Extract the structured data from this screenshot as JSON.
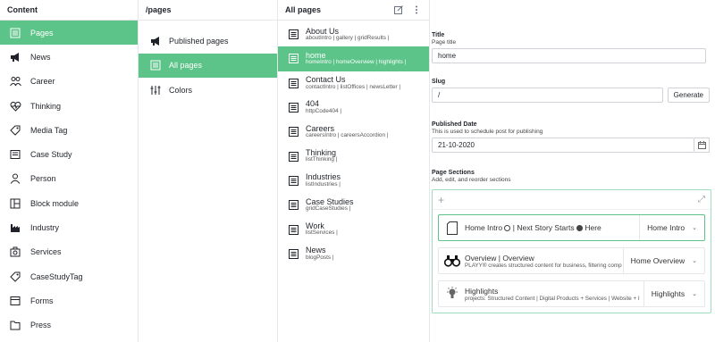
{
  "content_pane": {
    "title": "Content",
    "items": [
      {
        "label": "Pages",
        "icon": "pages-icon",
        "active": true
      },
      {
        "label": "News",
        "icon": "megaphone-icon"
      },
      {
        "label": "Career",
        "icon": "people-icon"
      },
      {
        "label": "Thinking",
        "icon": "heart-pulse-icon"
      },
      {
        "label": "Media Tag",
        "icon": "tag-icon"
      },
      {
        "label": "Case Study",
        "icon": "folder-icon"
      },
      {
        "label": "Person",
        "icon": "person-icon"
      },
      {
        "label": "Block module",
        "icon": "block-icon"
      },
      {
        "label": "Industry",
        "icon": "factory-icon"
      },
      {
        "label": "Services",
        "icon": "camera-icon"
      },
      {
        "label": "CaseStudyTag",
        "icon": "tag-icon"
      },
      {
        "label": "Forms",
        "icon": "forms-icon"
      },
      {
        "label": "Press",
        "icon": "press-icon"
      }
    ]
  },
  "pages_pane": {
    "title": "/pages",
    "items": [
      {
        "label": "Published pages",
        "icon": "megaphone-icon"
      },
      {
        "label": "All pages",
        "icon": "pages-icon",
        "active": true
      },
      {
        "label": "Colors",
        "icon": "sliders-icon"
      }
    ]
  },
  "all_pages_pane": {
    "title": "All pages",
    "items": [
      {
        "title": "About Us",
        "subtitle": "aboutIntro | gallery | gridResults |"
      },
      {
        "title": "home",
        "subtitle": "homeIntro | homeOverview | highlights |",
        "active": true
      },
      {
        "title": "Contact Us",
        "subtitle": "contactIntro | listOffices | newsLetter |"
      },
      {
        "title": "404",
        "subtitle": "httpCode404 |"
      },
      {
        "title": "Careers",
        "subtitle": "careersIntro | careersAccordion |"
      },
      {
        "title": "Thinking",
        "subtitle": "listThinking |"
      },
      {
        "title": "Industries",
        "subtitle": "listIndustries |"
      },
      {
        "title": "Case Studies",
        "subtitle": "gridCaseStudies |"
      },
      {
        "title": "Work",
        "subtitle": "listServices |"
      },
      {
        "title": "News",
        "subtitle": "blogPosts |"
      }
    ]
  },
  "editor": {
    "title_field": {
      "label": "Title",
      "desc": "Page title",
      "value": "home"
    },
    "slug_field": {
      "label": "Slug",
      "value": "/",
      "button": "Generate"
    },
    "date_field": {
      "label": "Published Date",
      "desc": "This is used to schedule post for publishing",
      "value": "21-10-2020"
    },
    "sections_field": {
      "label": "Page Sections",
      "desc": "Add, edit, and reorder sections",
      "items": [
        {
          "title_a": "Home Intro",
          "title_b": "| Next Story Starts",
          "title_c": "Here",
          "subtitle": "",
          "type": "Home Intro"
        },
        {
          "title_a": "Overview",
          "title_b": " | Overview",
          "title_c": "",
          "subtitle": "PLAYY® creates structured content for business, filtering comp",
          "type": "Home Overview"
        },
        {
          "title_a": "Highlights",
          "title_b": "",
          "title_c": "",
          "subtitle": "projects: Structured Content | Digital Products + Services | Website + I",
          "type": "Highlights"
        }
      ]
    }
  },
  "colors": {
    "accent": "#5cc389",
    "border": "#e5e7eb",
    "focus_border": "#9fdcb9"
  }
}
